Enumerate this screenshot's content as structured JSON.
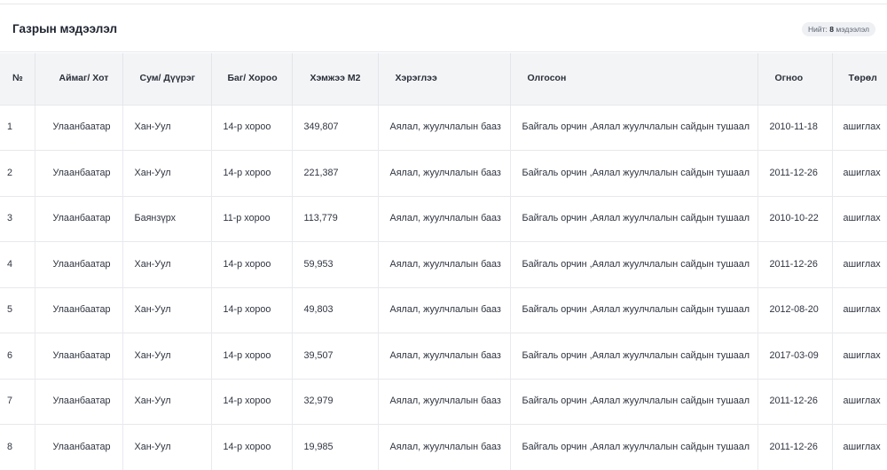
{
  "panel": {
    "title": "Газрын мэдээлэл",
    "count_label": "Нийт:",
    "count_value": "8",
    "count_unit": "мэдээлэл"
  },
  "table": {
    "columns": [
      "№",
      "Аймаг/ Хот",
      "Сум/ Дүүрэг",
      "Баг/ Хороо",
      "Хэмжээ М2",
      "Хэрэглээ",
      "Олгосон",
      "Огноо",
      "Төрөл"
    ],
    "rows": [
      [
        "1",
        "Улаанбаатар",
        "Хан-Уул",
        "14-р хороо",
        "349,807",
        "Аялал, жуулчлалын бааз",
        "Байгаль орчин ,Аялал жуулчлалын сайдын тушаал",
        "2010-11-18",
        "ашиглах"
      ],
      [
        "2",
        "Улаанбаатар",
        "Хан-Уул",
        "14-р хороо",
        "221,387",
        "Аялал, жуулчлалын бааз",
        "Байгаль орчин ,Аялал жуулчлалын сайдын тушаал",
        "2011-12-26",
        "ашиглах"
      ],
      [
        "3",
        "Улаанбаатар",
        "Баянзүрх",
        "11-р хороо",
        "113,779",
        "Аялал, жуулчлалын бааз",
        "Байгаль орчин ,Аялал жуулчлалын сайдын тушаал",
        "2010-10-22",
        "ашиглах"
      ],
      [
        "4",
        "Улаанбаатар",
        "Хан-Уул",
        "14-р хороо",
        "59,953",
        "Аялал, жуулчлалын бааз",
        "Байгаль орчин ,Аялал жуулчлалын сайдын тушаал",
        "2011-12-26",
        "ашиглах"
      ],
      [
        "5",
        "Улаанбаатар",
        "Хан-Уул",
        "14-р хороо",
        "49,803",
        "Аялал, жуулчлалын бааз",
        "Байгаль орчин ,Аялал жуулчлалын сайдын тушаал",
        "2012-08-20",
        "ашиглах"
      ],
      [
        "6",
        "Улаанбаатар",
        "Хан-Уул",
        "14-р хороо",
        "39,507",
        "Аялал, жуулчлалын бааз",
        "Байгаль орчин ,Аялал жуулчлалын сайдын тушаал",
        "2017-03-09",
        "ашиглах"
      ],
      [
        "7",
        "Улаанбаатар",
        "Хан-Уул",
        "14-р хороо",
        "32,979",
        "Аялал, жуулчлалын бааз",
        "Байгаль орчин ,Аялал жуулчлалын сайдын тушаал",
        "2011-12-26",
        "ашиглах"
      ],
      [
        "8",
        "Улаанбаатар",
        "Хан-Уул",
        "14-р хороо",
        "19,985",
        "Аялал, жуулчлалын бааз",
        "Байгаль орчин ,Аялал жуулчлалын сайдын тушаал",
        "2011-12-26",
        "ашиглах"
      ]
    ]
  }
}
